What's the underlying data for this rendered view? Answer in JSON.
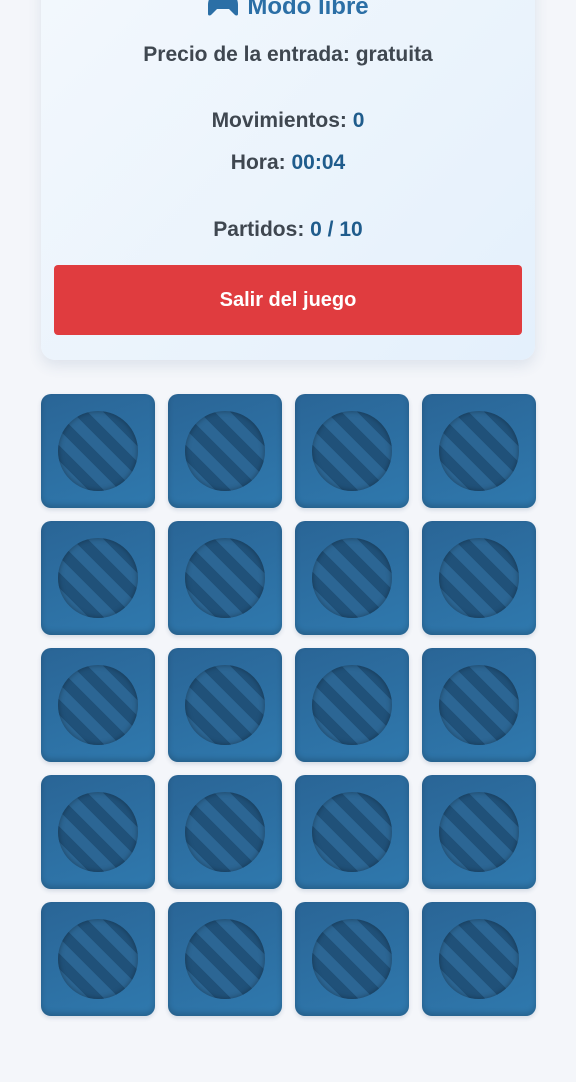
{
  "game": {
    "mode_title": "Modo libre",
    "mode_icon": "gamepad-icon",
    "price_label": "Precio de la entrada:",
    "price_value": "gratuita",
    "moves_label": "Movimientos:",
    "moves_value": "0",
    "time_label": "Hora:",
    "time_value": "00:04",
    "matches_label": "Partidos:",
    "matches_value": "0 / 10",
    "exit_label": "Salir del juego"
  },
  "board": {
    "rows": 5,
    "columns": 4,
    "face_down_icon": "striped-circle-icon",
    "tiles": [
      {
        "state": "face-down"
      },
      {
        "state": "face-down"
      },
      {
        "state": "face-down"
      },
      {
        "state": "face-down"
      },
      {
        "state": "face-down"
      },
      {
        "state": "face-down"
      },
      {
        "state": "face-down"
      },
      {
        "state": "face-down"
      },
      {
        "state": "face-down"
      },
      {
        "state": "face-down"
      },
      {
        "state": "face-down"
      },
      {
        "state": "face-down"
      },
      {
        "state": "face-down"
      },
      {
        "state": "face-down"
      },
      {
        "state": "face-down"
      },
      {
        "state": "face-down"
      },
      {
        "state": "face-down"
      },
      {
        "state": "face-down"
      },
      {
        "state": "face-down"
      },
      {
        "state": "face-down"
      }
    ]
  },
  "colors": {
    "accent": "#2b6fa6",
    "value_text": "#1f5c8c",
    "exit_button": "#e03c3f",
    "tile": "#2a6596",
    "background": "#f4f6fa"
  }
}
